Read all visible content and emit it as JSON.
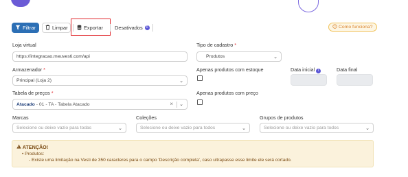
{
  "toolbar": {
    "filter_label": "Filtrar",
    "clear_label": "Limpar",
    "export_label": "Exportar",
    "disabled_label": "Desativados",
    "disabled_count": "0",
    "help_label": "Como funciona?"
  },
  "form": {
    "store": {
      "label": "Loja virtual",
      "value": "https://integracao.meuvesti.com/api"
    },
    "register_type": {
      "label": "Tipo de cadastro",
      "required": "*",
      "value": "Produtos"
    },
    "warehouse": {
      "label": "Armazenador",
      "required": "*",
      "value": "Principal (Loja 2)"
    },
    "only_stock": {
      "label": "Apenas produtos com estoque"
    },
    "start_date": {
      "label": "Data inicial",
      "info": "i"
    },
    "end_date": {
      "label": "Data final"
    },
    "price_table": {
      "label": "Tabela de preços",
      "required": "*",
      "value_bold": "Atacado",
      "value_rest": " - 01 - TA - Tabela Atacado",
      "clear": "×"
    },
    "only_price": {
      "label": "Apenas produtos com preço"
    },
    "brands": {
      "label": "Marcas",
      "placeholder": "Selecione ou deixe vazio para todas"
    },
    "collections": {
      "label": "Coleções",
      "placeholder": "Selecione ou deixe vazio para todos"
    },
    "product_groups": {
      "label": "Grupos de produtos",
      "placeholder": "Selecione ou deixe vazio para todos"
    }
  },
  "alert": {
    "title": "ATENÇÃO!",
    "item": "Produtos:",
    "text": "Existe uma limitação na Vesti de 350 caracteres para o campo 'Descrição completa', caso ultrapasse esse limite ele será cortado."
  },
  "colors": {
    "primary": "#2c6fb5",
    "highlight": "#e0262b",
    "alert_bg": "#fbf2dc",
    "help_text": "#d9822b",
    "badge": "#5b56d6"
  }
}
